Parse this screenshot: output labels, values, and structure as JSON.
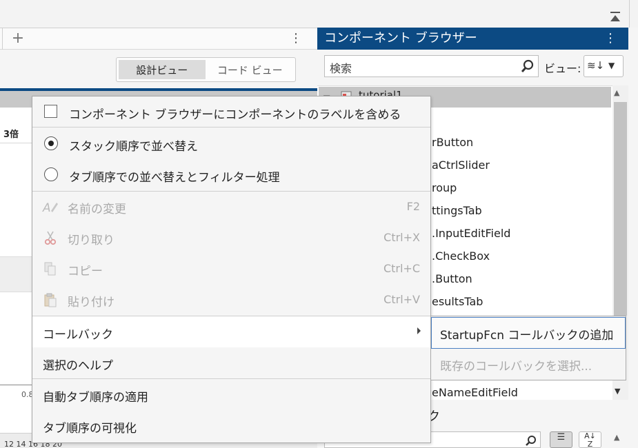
{
  "designer": {
    "view_toggle": {
      "design_label": "設計ビュー",
      "code_label": "コード ビュー",
      "active": "design"
    },
    "zoom_label": "3倍",
    "axis_tick": "0.8",
    "ruler_numbers": "12  14  16  18  20"
  },
  "component_browser": {
    "title": "コンポーネント ブラウザー",
    "search_placeholder": "検索",
    "view_label": "ビュー:",
    "tree": {
      "root": "tutorial1",
      "items": [
        "rButton",
        "aCtrlSlider",
        "roup",
        "ttingsTab",
        ".InputEditField",
        ".CheckBox",
        ".Button",
        "esultsTab",
        "eNameEditField"
      ]
    },
    "lower_label": "ク"
  },
  "context_menu": {
    "include_labels": {
      "label": "コンポーネント ブラウザーにコンポーネントのラベルを含める",
      "checked": false
    },
    "sort_stack": {
      "label": "スタック順序で並べ替え",
      "selected": true
    },
    "sort_tab": {
      "label": "タブ順序での並べ替えとフィルター処理",
      "selected": false
    },
    "rename": {
      "label": "名前の変更",
      "shortcut": "F2"
    },
    "cut": {
      "label": "切り取り",
      "shortcut": "Ctrl+X"
    },
    "copy": {
      "label": "コピー",
      "shortcut": "Ctrl+C"
    },
    "paste": {
      "label": "貼り付け",
      "shortcut": "Ctrl+V"
    },
    "callback": {
      "label": "コールバック"
    },
    "help": {
      "label": "選択のヘルプ"
    },
    "auto_tab": {
      "label": "自動タブ順序の適用"
    },
    "show_tab": {
      "label": "タブ順序の可視化"
    }
  },
  "callback_submenu": {
    "add_startup": "StartupFcn コールバックの追加",
    "select_existing": "既存のコールバックを選択..."
  },
  "colors": {
    "header_blue": "#0c4a83",
    "menu_bg": "#f5f5f5",
    "disabled_text": "#a9a9a9",
    "focus_border": "#4a7fc2"
  }
}
